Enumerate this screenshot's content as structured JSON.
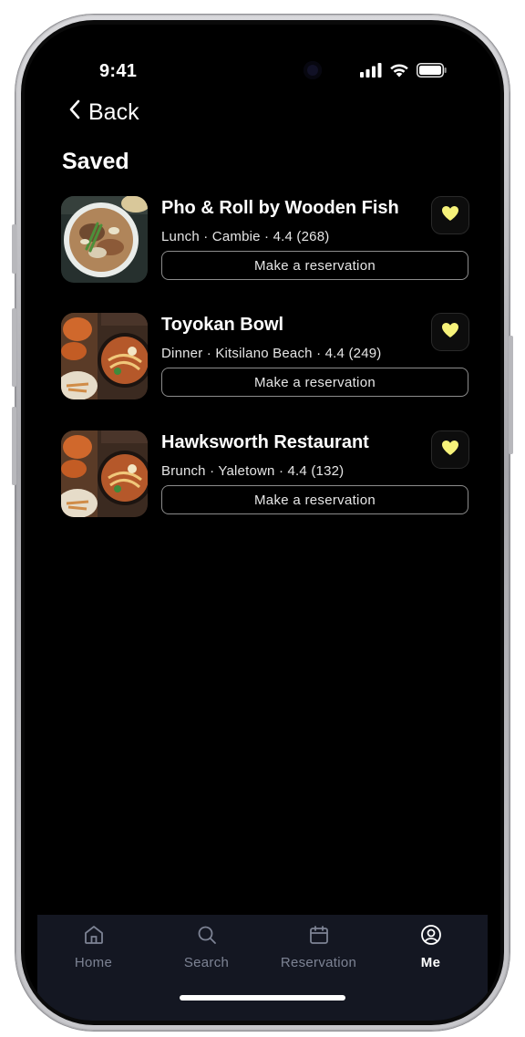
{
  "status_bar": {
    "time": "9:41",
    "icons": [
      "cellular-signal-icon",
      "wifi-icon",
      "battery-icon"
    ]
  },
  "nav": {
    "back_label": "Back"
  },
  "page": {
    "title": "Saved"
  },
  "saved_items": [
    {
      "name": "Pho & Roll by Wooden Fish",
      "meta": "Lunch · Cambie · 4.4 (268)",
      "action_label": "Make a reservation",
      "favorited": true
    },
    {
      "name": "Toyokan Bowl",
      "meta": "Dinner · Kitsilano Beach · 4.4 (249)",
      "action_label": "Make a reservation",
      "favorited": true
    },
    {
      "name": "Hawksworth Restaurant",
      "meta": "Brunch · Yaletown · 4.4 (132)",
      "action_label": "Make a reservation",
      "favorited": true
    }
  ],
  "tab_bar": {
    "tabs": [
      {
        "label": "Home",
        "icon": "home-icon",
        "active": false
      },
      {
        "label": "Search",
        "icon": "search-icon",
        "active": false
      },
      {
        "label": "Reservation",
        "icon": "calendar-icon",
        "active": false
      },
      {
        "label": "Me",
        "icon": "user-circle-icon",
        "active": true
      }
    ]
  },
  "colors": {
    "background": "#000000",
    "favorite_heart": "#f6f27a",
    "tab_bar_bg": "#141722",
    "tab_inactive": "#7d8394",
    "tab_active": "#ffffff"
  }
}
